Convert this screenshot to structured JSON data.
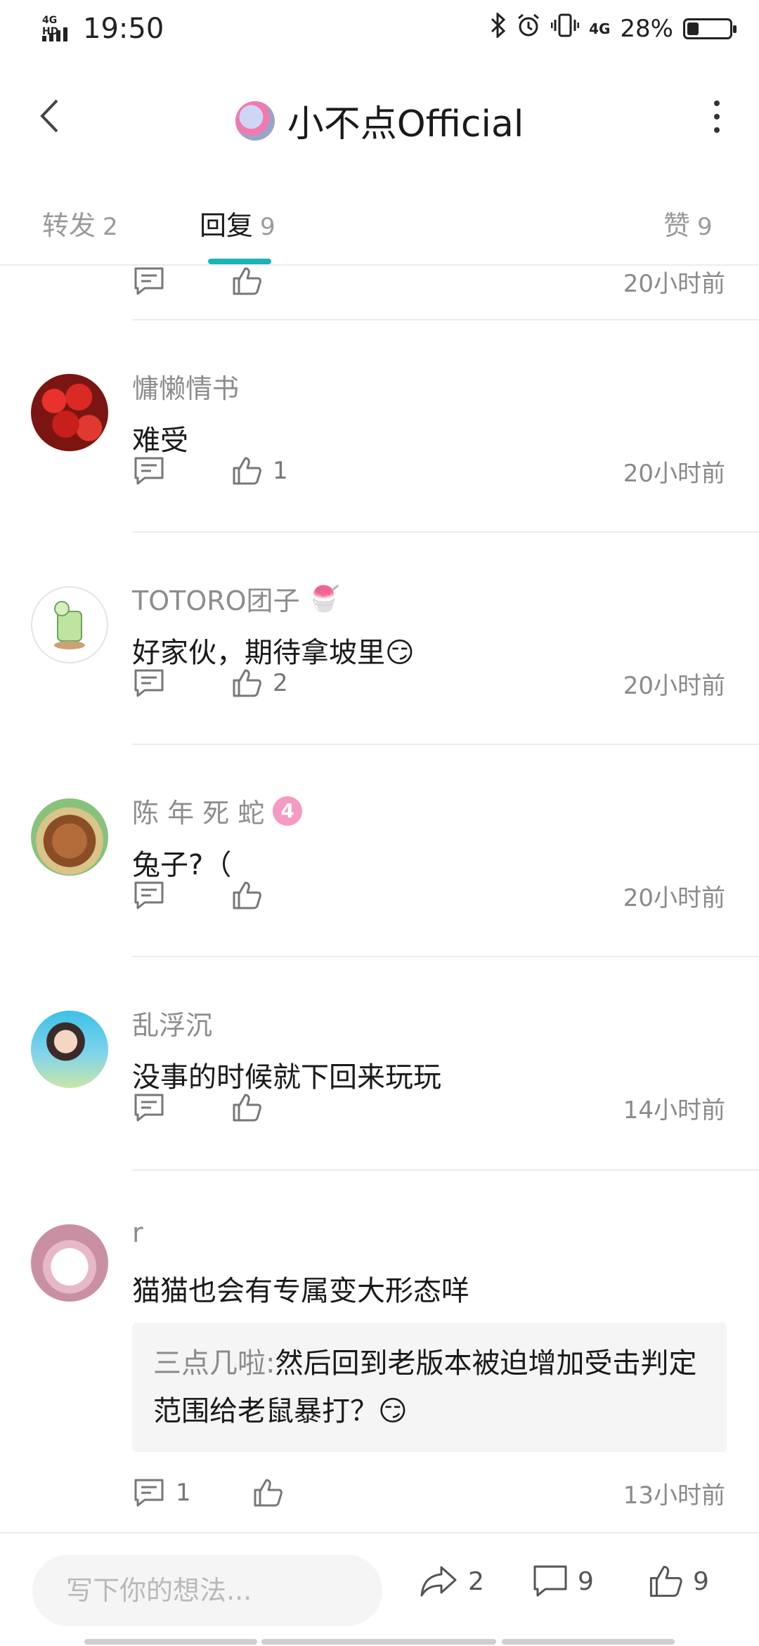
{
  "status_bar": {
    "network": "4G HD",
    "time": "19:50",
    "mobile": "4G",
    "battery_percent": "28%",
    "battery_level": 0.28,
    "icons": [
      "bluetooth-icon",
      "alarm-icon",
      "vibrate-icon",
      "4g-icon",
      "battery-icon"
    ]
  },
  "header": {
    "title": "小不点Official"
  },
  "tabs": [
    {
      "label": "转发",
      "count": "2"
    },
    {
      "label": "回复",
      "count": "9"
    },
    {
      "label": "赞",
      "count": "9"
    }
  ],
  "partial_row": {
    "time": "20小时前"
  },
  "comments": [
    {
      "name": "慵懒情书",
      "text": "难受",
      "likes": "1",
      "time": "20小时前"
    },
    {
      "name": "TOTORO团子",
      "badge": "🍧",
      "text": "好家伙，期待拿坡里😏",
      "likes": "2",
      "time": "20小时前"
    },
    {
      "name": "陈 年 死 蛇",
      "level": "4",
      "text": "兔子?（",
      "likes": "",
      "time": "20小时前"
    },
    {
      "name": "乱浮沉",
      "text": "没事的时候就下回来玩玩",
      "likes": "",
      "time": "14小时前"
    },
    {
      "name": "r",
      "text": "猫猫也会有专属变大形态咩",
      "quote_author": "三点几啦",
      "quote_sep": ":",
      "quote_text": "然后回到老版本被迫增加受击判定范围给老鼠暴打？😏",
      "replies": "1",
      "likes": "",
      "time": "13小时前"
    }
  ],
  "bottom_bar": {
    "placeholder": "写下你的想法...",
    "forward_count": "2",
    "comment_count": "9",
    "like_count": "9"
  }
}
